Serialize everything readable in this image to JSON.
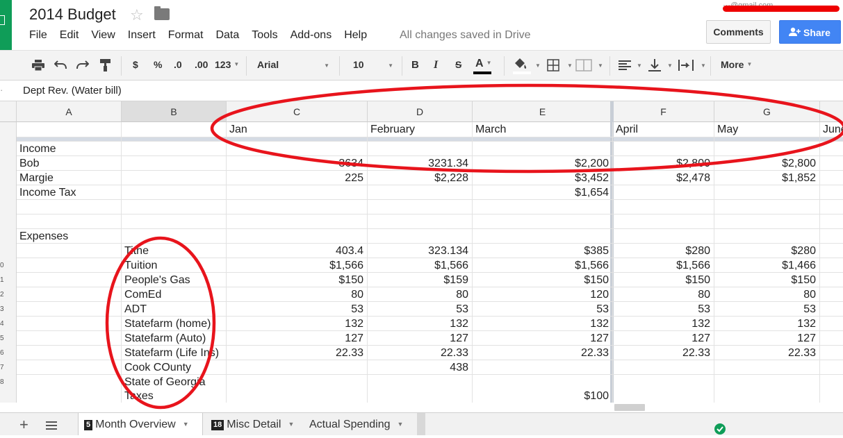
{
  "doc": {
    "title": "2014 Budget",
    "save_status": "All changes saved in Drive",
    "user_email_fragment": "···@gmail.com"
  },
  "menu": [
    "File",
    "Edit",
    "View",
    "Insert",
    "Format",
    "Data",
    "Tools",
    "Add-ons",
    "Help"
  ],
  "buttons": {
    "comments": "Comments",
    "share": "Share"
  },
  "toolbar": {
    "currency": "$",
    "percent": "%",
    "dec_less": ".0",
    "dec_more": ".00",
    "format_more": "123",
    "font": "Arial",
    "font_size": "10",
    "bold": "B",
    "italic": "I",
    "strike": "S",
    "text_color": "A",
    "more": "More"
  },
  "formula_bar": {
    "content": "Dept Rev. (Water bill)"
  },
  "columns": [
    "A",
    "B",
    "C",
    "D",
    "E",
    "F",
    "G"
  ],
  "row_numbers": [
    "0",
    "1",
    "2",
    "3",
    "4",
    "5",
    "6",
    "7",
    "8"
  ],
  "sheet": {
    "months": [
      "Jan",
      "February",
      "March",
      "April",
      "May",
      "June"
    ],
    "income_label": "Income",
    "income_rows": [
      {
        "name": "Bob",
        "values": [
          "3634",
          "3231.34",
          "$2,200",
          "$2,800",
          "$2,800"
        ]
      },
      {
        "name": "Margie",
        "values": [
          "225",
          "$2,228",
          "$3,452",
          "$2,478",
          "$1,852"
        ]
      },
      {
        "name": "Income Tax",
        "values": [
          "",
          "",
          "$1,654",
          "",
          ""
        ]
      }
    ],
    "expenses_label": "Expenses",
    "expense_rows": [
      {
        "name": "Tithe",
        "values": [
          "403.4",
          "323.134",
          "$385",
          "$280",
          "$280"
        ]
      },
      {
        "name": "Tuition",
        "values": [
          "$1,566",
          "$1,566",
          "$1,566",
          "$1,566",
          "$1,466"
        ]
      },
      {
        "name": "People's Gas",
        "values": [
          "$150",
          "$159",
          "$150",
          "$150",
          "$150"
        ]
      },
      {
        "name": "ComEd",
        "values": [
          "80",
          "80",
          "120",
          "80",
          "80"
        ]
      },
      {
        "name": "ADT",
        "values": [
          "53",
          "53",
          "53",
          "53",
          "53"
        ]
      },
      {
        "name": "Statefarm (home)",
        "values": [
          "132",
          "132",
          "132",
          "132",
          "132"
        ]
      },
      {
        "name": "Statefarm (Auto)",
        "values": [
          "127",
          "127",
          "127",
          "127",
          "127"
        ]
      },
      {
        "name": "Statefarm (Life Ins)",
        "values": [
          "22.33",
          "22.33",
          "22.33",
          "22.33",
          "22.33"
        ]
      },
      {
        "name": "Cook COunty",
        "values": [
          "",
          "438",
          "",
          "",
          ""
        ]
      }
    ],
    "georgia": {
      "line1": "State of Georgia",
      "line2": "Taxes",
      "march": "$100"
    }
  },
  "tabs": [
    {
      "badge": "5",
      "label": "Month Overview",
      "active": true
    },
    {
      "badge": "18",
      "label": "Misc Detail",
      "active": false
    },
    {
      "badge": "",
      "label": "Actual Spending",
      "active": false
    }
  ],
  "colors": {
    "brand_green": "#0f9d58",
    "share_blue": "#4285f4",
    "annotation_red": "#e8141c"
  }
}
